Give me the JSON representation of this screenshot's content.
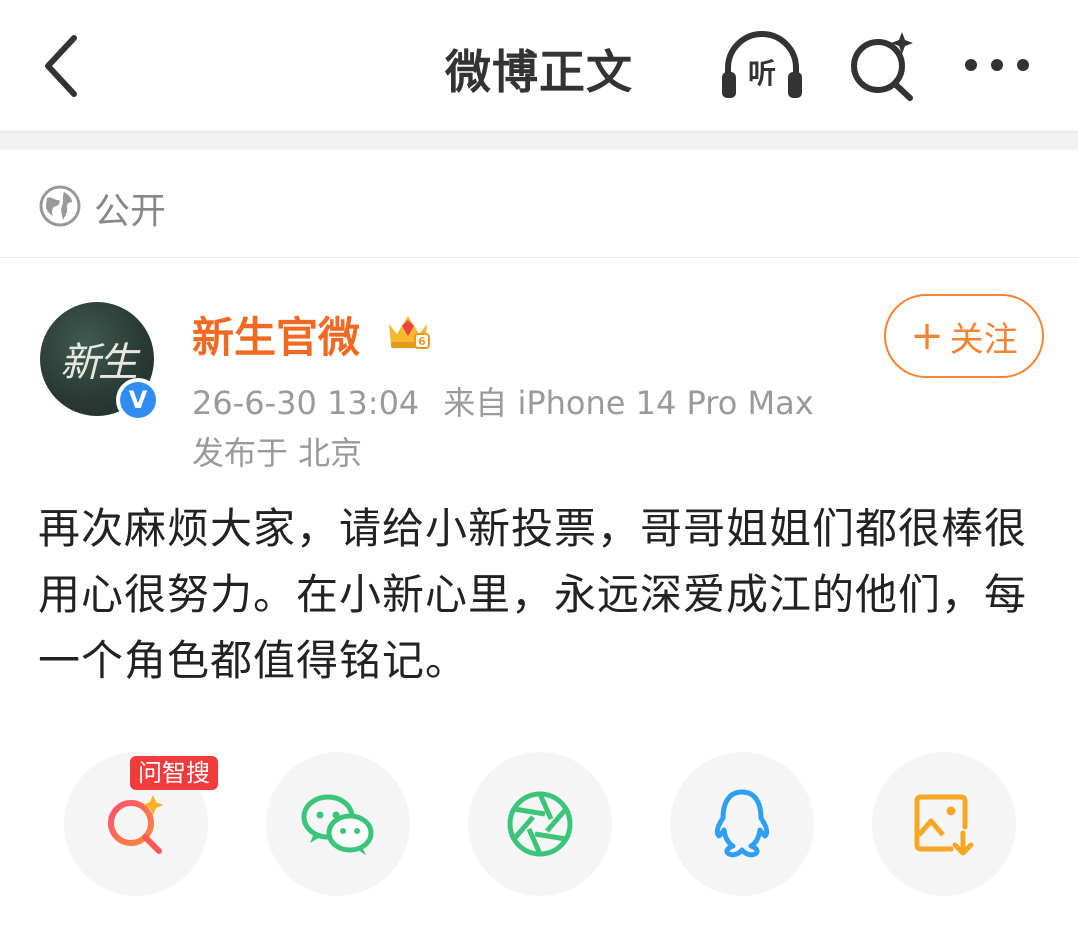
{
  "nav": {
    "title": "微博正文",
    "listen_label": "听",
    "icons": [
      "back-arrow-icon",
      "headphones-icon",
      "ai-search-icon",
      "more-icon"
    ]
  },
  "visibility": {
    "label": "公开",
    "icon": "globe-icon"
  },
  "author": {
    "name": "新生官微",
    "avatar_text": "新生",
    "verified_mark": "V",
    "follow_plus": "+",
    "follow_label": "关注"
  },
  "meta": {
    "timestamp": "26-6-30 13:04",
    "source": "来自 iPhone 14 Pro Max",
    "location": "发布于 北京"
  },
  "post": {
    "text": "再次麻烦大家，请给小新投票，哥哥姐姐们都很棒很用心很努力。在小新心里，永远深爱成江的他们，每一个角色都值得铭记。"
  },
  "share": {
    "badge": "问智搜",
    "items": [
      "ai-search-share-icon",
      "wechat-icon",
      "moments-icon",
      "qq-icon",
      "save-image-icon"
    ]
  },
  "colors": {
    "accent_orange": "#f26a21",
    "follow_orange": "#f48434",
    "wechat_green": "#3ac57a",
    "qq_blue": "#2f9ef5",
    "save_orange": "#f5a623",
    "badge_red": "#f23c3c"
  }
}
